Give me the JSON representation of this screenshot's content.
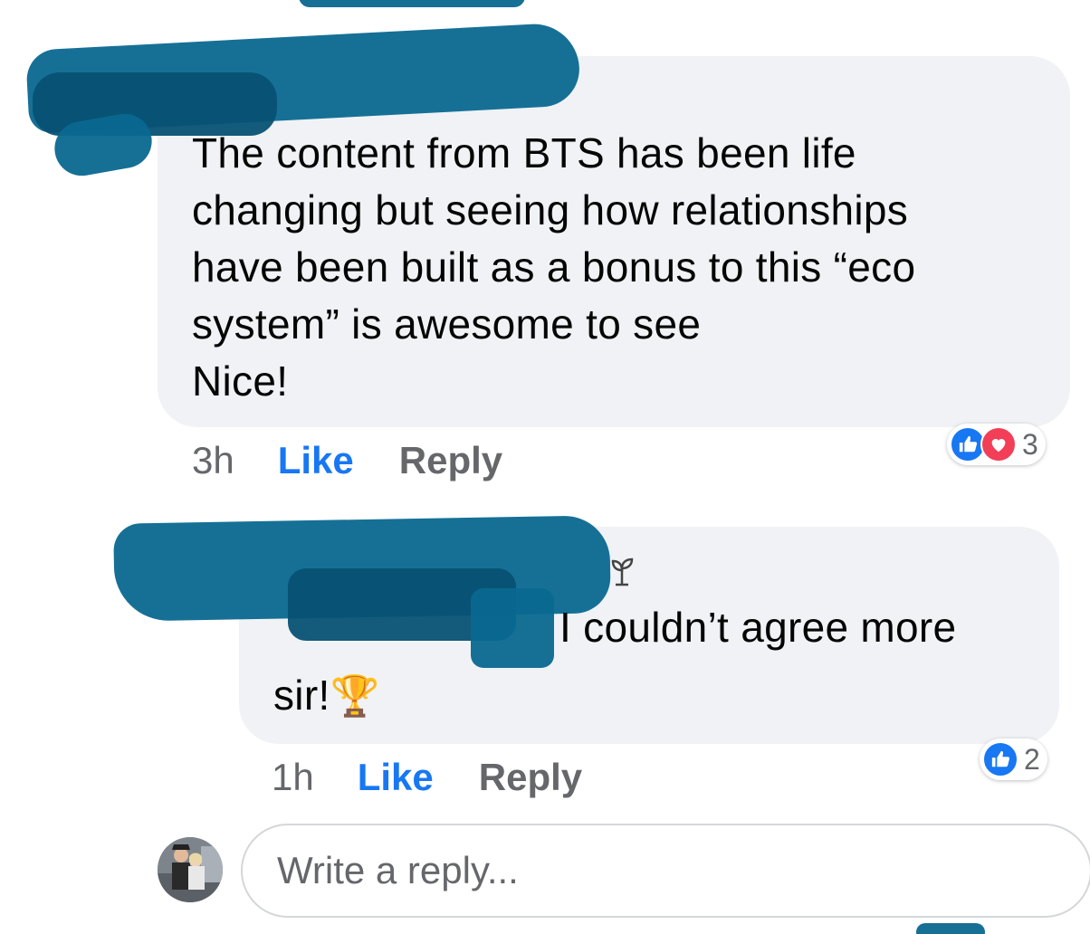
{
  "comments": [
    {
      "text_lines": [
        "The content from BTS has been life",
        "changing but seeing how relationships",
        "have been built as a bonus to this “eco",
        "system” is awesome to see",
        "Nice!"
      ],
      "time": "3h",
      "like_label": "Like",
      "reply_label": "Reply",
      "reaction_count": "3",
      "reactions": [
        "like-icon",
        "love-icon"
      ]
    },
    {
      "text_line_1": "I couldn’t agree more",
      "text_line_2_prefix": "sir!",
      "emoji": "🏆",
      "time": "1h",
      "like_label": "Like",
      "reply_label": "Reply",
      "reaction_count": "2",
      "reactions": [
        "like-icon"
      ]
    }
  ],
  "reply_box": {
    "placeholder": "Write a reply..."
  },
  "colors": {
    "like_blue": "#1877f2",
    "love_red": "#f33e58",
    "bubble_gray": "#f0f2f5",
    "redaction_blue": "#0a6890"
  }
}
